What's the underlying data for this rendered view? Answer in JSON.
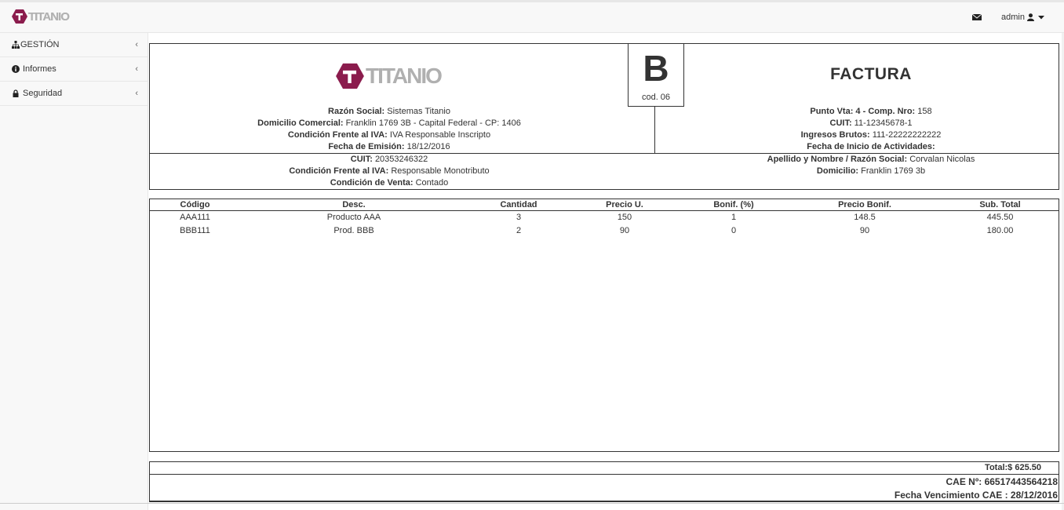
{
  "brand": {
    "name": "TITANIO"
  },
  "topbar": {
    "user_label": "admin"
  },
  "sidebar": {
    "items": [
      {
        "label": "GESTIÓN",
        "icon": "sitemap-icon"
      },
      {
        "label": "Informes",
        "icon": "info-circle-icon"
      },
      {
        "label": "Seguridad",
        "icon": "lock-icon"
      }
    ]
  },
  "invoice": {
    "letter": "B",
    "code": "cod. 06",
    "doc_type": "FACTURA",
    "logo_text": "TITANIO",
    "emisor": {
      "razon_label": "Razón Social:",
      "razon_value": "Sistemas Titanio",
      "domicilio_label": "Domicilio Comercial:",
      "domicilio_value": "Franklin 1769 3B - Capital Federal - CP: 1406",
      "iva_label": "Condición Frente al IVA:",
      "iva_value": "IVA Responsable Inscripto",
      "fecha_label": "Fecha de Emisión:",
      "fecha_value": "18/12/2016"
    },
    "comprobante": {
      "punto_label": "Punto Vta: 4 - Comp. Nro:",
      "punto_value": "158",
      "cuit_label": "CUIT:",
      "cuit_value": "11-12345678-1",
      "iibb_label": "Ingresos Brutos:",
      "iibb_value": "111-22222222222",
      "inicio_label": "Fecha de Inicio de Actividades:",
      "inicio_value": ""
    },
    "cliente": {
      "cuit_label": "CUIT:",
      "cuit_value": "20353246322",
      "iva_label": "Condición Frente al IVA:",
      "iva_value": "Responsable Monotributo",
      "venta_label": "Condición de Venta:",
      "venta_value": "Contado",
      "nombre_label": "Apellido y Nombre / Razón Social:",
      "nombre_value": "Corvalan Nicolas",
      "domicilio_label": "Domicilio:",
      "domicilio_value": "Franklin 1769 3b"
    },
    "table": {
      "headers": [
        "Código",
        "Desc.",
        "Cantidad",
        "Precio U.",
        "Bonif. (%)",
        "Precio Bonif.",
        "Sub. Total"
      ],
      "rows": [
        [
          "AAA111",
          "Producto AAA",
          "3",
          "150",
          "1",
          "148.5",
          "445.50"
        ],
        [
          "BBB111",
          "Prod. BBB",
          "2",
          "90",
          "0",
          "90",
          "180.00"
        ]
      ]
    },
    "total_label": "Total:$ 625.50",
    "cae": "CAE Nº: 66517443564218",
    "cae_vto": "Fecha Vencimiento CAE : 28/12/2016"
  },
  "colors": {
    "brand": "#8b1c4d",
    "logo_gray": "#b0b0b0"
  }
}
